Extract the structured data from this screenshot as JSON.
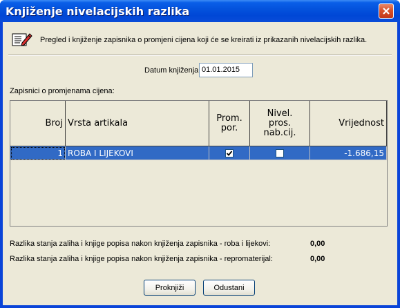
{
  "window": {
    "title": "Knjiženje nivelacijskih razlika"
  },
  "header": {
    "icon": "edit-document-icon",
    "description": "Pregled i knjiženje zapisnika o promjeni cijena koji će se kreirati iz prikazanih nivelacijskih razlika."
  },
  "date": {
    "label": "Datum knjiženja:",
    "value": "01.01.2015"
  },
  "grid": {
    "caption": "Zapisnici o promjenama cijena:",
    "columns": [
      "Broj",
      "Vrsta artikala",
      "Prom.\npor.",
      "Nivel.\npros.\nnab.cij.",
      "Vrijednost"
    ],
    "rows": [
      {
        "broj": "1",
        "vrsta": "ROBA I LIJEKOVI",
        "prom_por": true,
        "nivel": false,
        "vrijednost": "-1.686,15"
      }
    ]
  },
  "summary": [
    {
      "label": "Razlika stanja zaliha i knjige popisa nakon knjiženja zapisnika - roba i lijekovi:",
      "value": "0,00"
    },
    {
      "label": "Razlika stanja zaliha i knjige popisa nakon knjiženja zapisnika - repromaterijal:",
      "value": "0,00"
    }
  ],
  "buttons": {
    "post": "Proknjiži",
    "cancel": "Odustani"
  },
  "colors": {
    "titlebar": "#0453dd",
    "selection": "#316ac5",
    "face": "#ece9d8"
  }
}
